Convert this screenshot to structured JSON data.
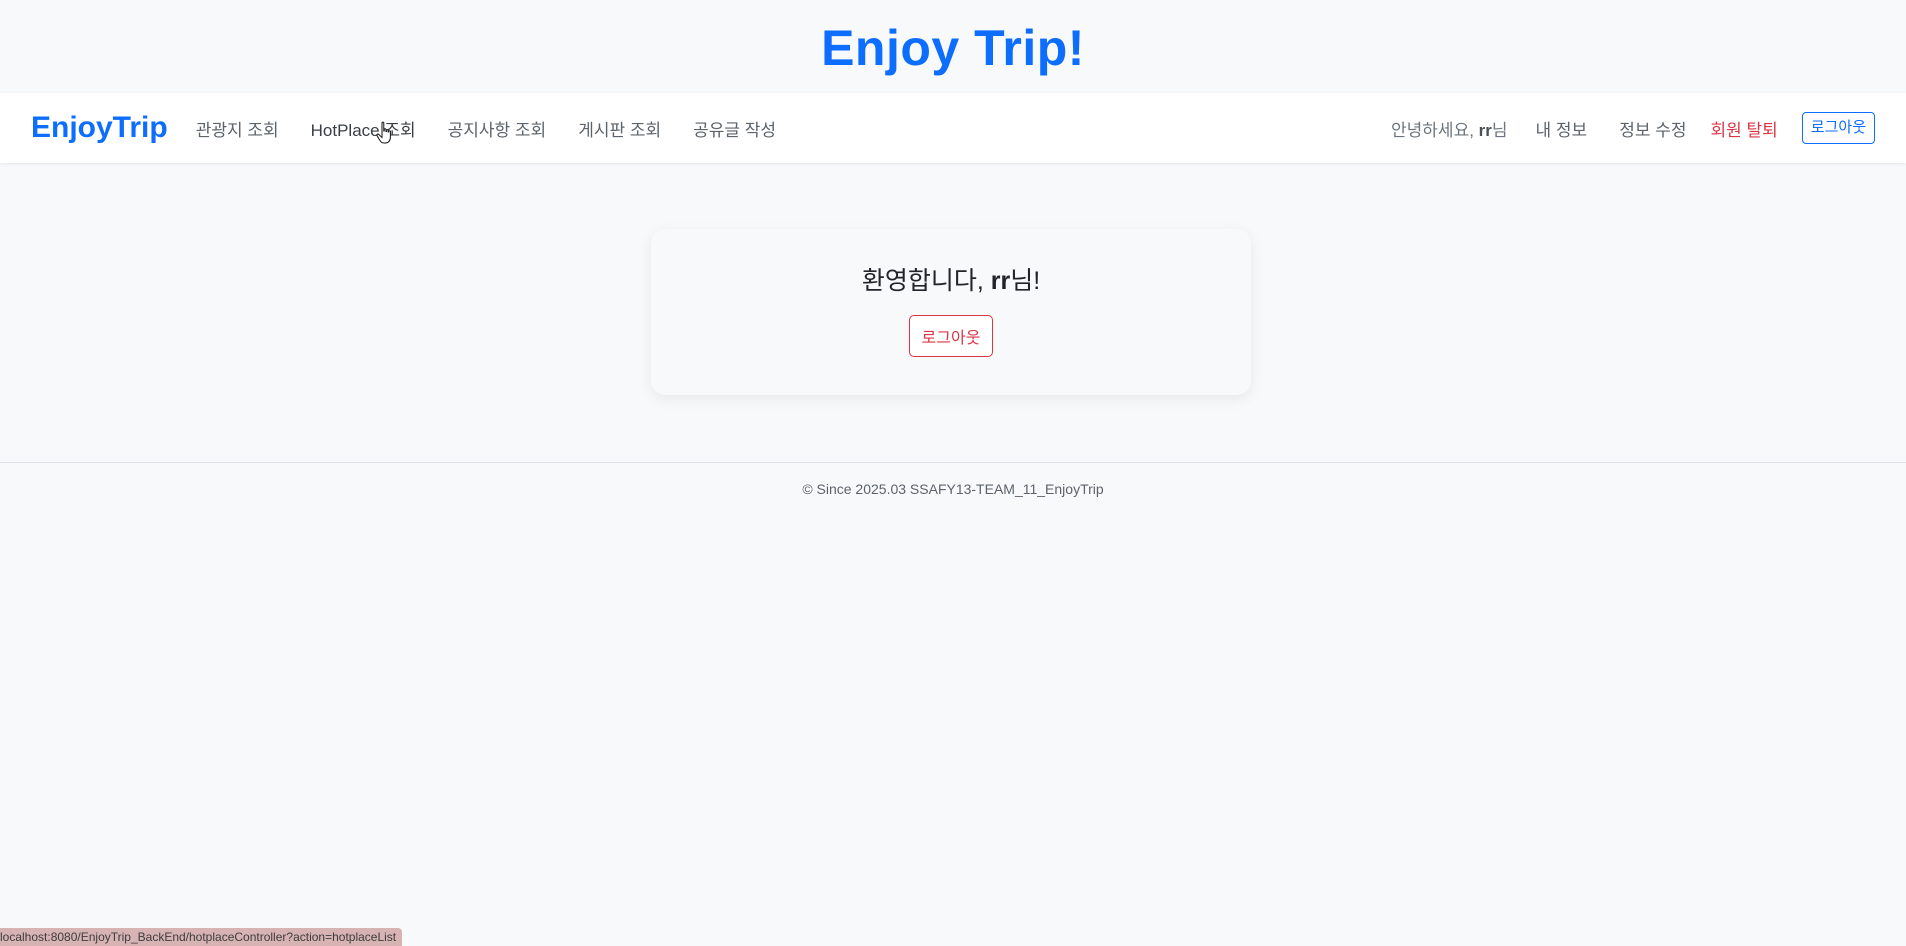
{
  "header": {
    "title": "Enjoy Trip!"
  },
  "navbar": {
    "brand": "EnjoyTrip",
    "items": [
      {
        "label": "관광지 조회"
      },
      {
        "label": "HotPlace 조회"
      },
      {
        "label": "공지사항 조회"
      },
      {
        "label": "게시판 조회"
      },
      {
        "label": "공유글 작성"
      }
    ],
    "greeting_prefix": "안녕하세요, ",
    "username": "rr",
    "greeting_suffix": "님",
    "my_info": "내 정보",
    "edit_info": "정보 수정",
    "withdraw": "회원 탈퇴",
    "logout": "로그아웃"
  },
  "main": {
    "welcome_prefix": "환영합니다, ",
    "username": "rr",
    "welcome_suffix": "님!",
    "logout_button": "로그아웃"
  },
  "footer": {
    "text": "© Since 2025.03 SSAFY13-TEAM_11_EnjoyTrip"
  },
  "status_bar": {
    "url": "localhost:8080/EnjoyTrip_BackEnd/hotplaceController?action=hotplaceList"
  },
  "colors": {
    "primary": "#0d6efd",
    "danger": "#dc3545",
    "background": "#f8f9fa"
  },
  "icons": {
    "cursor": "hand-pointer-icon"
  }
}
